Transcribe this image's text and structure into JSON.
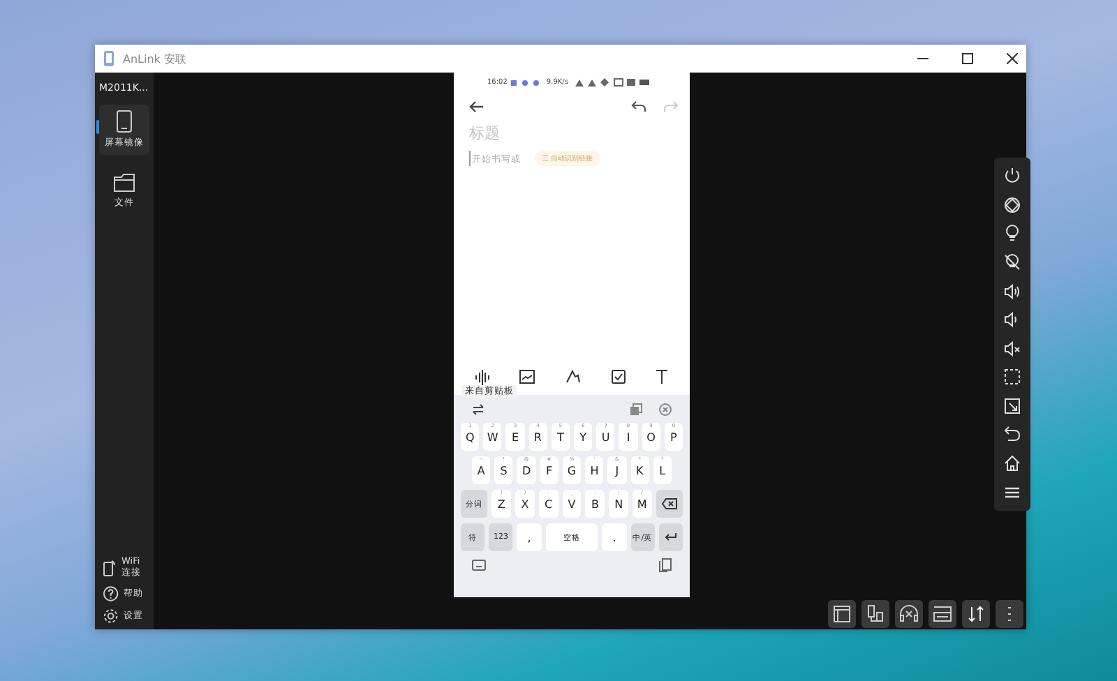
{
  "window": {
    "title": "AnLink 安联"
  },
  "sidebar": {
    "device": "M2011K...",
    "items": [
      {
        "label": "屏幕镜像",
        "kind": "phone",
        "selected": true
      },
      {
        "label": "文件",
        "kind": "folder",
        "selected": false
      }
    ],
    "bottom_items": [
      {
        "label": "WiFi连接",
        "kind": "wifi"
      },
      {
        "label": "帮助",
        "kind": "help"
      },
      {
        "label": "设置",
        "kind": "settings"
      }
    ]
  },
  "phone": {
    "status_time": "16:02",
    "status_speed": "9.9K/s",
    "note": {
      "title_placeholder": "标题",
      "body_placeholder": "开始书写或",
      "chip": "三 自动识别链接"
    },
    "clipboard_tooltip": "来自剪贴板",
    "keyboard": {
      "rows": [
        {
          "keys": [
            {
              "kind": "letter",
              "label": "Q",
              "hint": "1"
            },
            {
              "kind": "letter",
              "label": "W",
              "hint": "2"
            },
            {
              "kind": "letter",
              "label": "E",
              "hint": "3"
            },
            {
              "kind": "letter",
              "label": "R",
              "hint": "4"
            },
            {
              "kind": "letter",
              "label": "T",
              "hint": "5"
            },
            {
              "kind": "letter",
              "label": "Y",
              "hint": "6"
            },
            {
              "kind": "letter",
              "label": "U",
              "hint": "7"
            },
            {
              "kind": "letter",
              "label": "I",
              "hint": "8"
            },
            {
              "kind": "letter",
              "label": "O",
              "hint": "9"
            },
            {
              "kind": "letter",
              "label": "P",
              "hint": "0"
            }
          ]
        },
        {
          "keys": [
            {
              "kind": "letter",
              "label": "A",
              "hint": "~"
            },
            {
              "kind": "letter",
              "label": "S",
              "hint": "!"
            },
            {
              "kind": "letter",
              "label": "D",
              "hint": "@"
            },
            {
              "kind": "letter",
              "label": "F",
              "hint": "#"
            },
            {
              "kind": "letter",
              "label": "G",
              "hint": "%"
            },
            {
              "kind": "letter",
              "label": "H",
              "hint": "'"
            },
            {
              "kind": "letter",
              "label": "J",
              "hint": "&"
            },
            {
              "kind": "letter",
              "label": "K",
              "hint": "*"
            },
            {
              "kind": "letter",
              "label": "L",
              "hint": "?"
            }
          ]
        },
        {
          "keys": [
            {
              "kind": "function",
              "label": "分词"
            },
            {
              "kind": "letter",
              "label": "Z",
              "hint": "("
            },
            {
              "kind": "letter",
              "label": "X",
              "hint": ")"
            },
            {
              "kind": "letter",
              "label": "C",
              "hint": "-"
            },
            {
              "kind": "letter",
              "label": "V",
              "hint": "_"
            },
            {
              "kind": "letter",
              "label": "B",
              "hint": ":"
            },
            {
              "kind": "letter",
              "label": "N",
              "hint": ";"
            },
            {
              "kind": "letter",
              "label": "M",
              "hint": "/"
            },
            {
              "kind": "backspace"
            }
          ]
        },
        {
          "keys": [
            {
              "kind": "function",
              "label": "符"
            },
            {
              "kind": "function",
              "label": "123"
            },
            {
              "kind": "letter",
              "label": ","
            },
            {
              "kind": "space",
              "label": "空格"
            },
            {
              "kind": "letter",
              "label": "."
            },
            {
              "kind": "function",
              "label": "中/英"
            },
            {
              "kind": "enter"
            }
          ]
        }
      ]
    }
  }
}
